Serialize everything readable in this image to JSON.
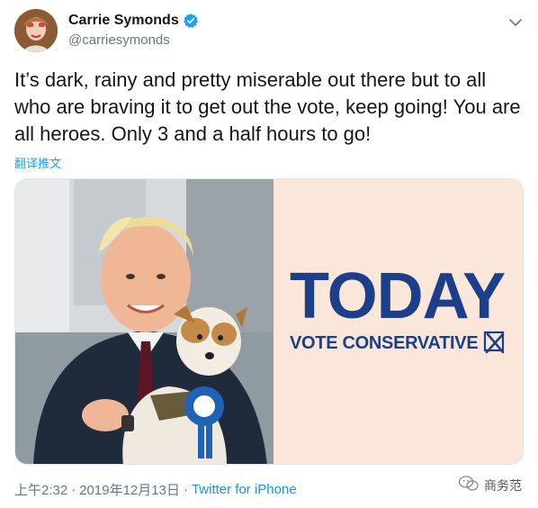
{
  "author": {
    "display_name": "Carrie Symonds",
    "handle": "@carriesymonds",
    "verified": true
  },
  "tweet": {
    "text": "It’s dark, rainy and pretty miserable out there but to all who are braving it to get out the vote, keep going! You are all heroes. Only 3 and a half hours to go!",
    "translate_label": "翻译推文"
  },
  "media": {
    "poster_headline": "TODAY",
    "poster_subline": "VOTE CONSERVATIVE",
    "colors": {
      "poster_bg": "#fbe7da",
      "poster_text": "#1b3f8b"
    }
  },
  "footer": {
    "time": "上午2:32",
    "separator1": "·",
    "date": "2019年12月13日",
    "separator2": "·",
    "source": "Twitter for iPhone"
  },
  "watermark": {
    "label": "商务范"
  },
  "colors": {
    "link": "#1da1f2",
    "muted": "#657786",
    "verified": "#1da1f2"
  }
}
